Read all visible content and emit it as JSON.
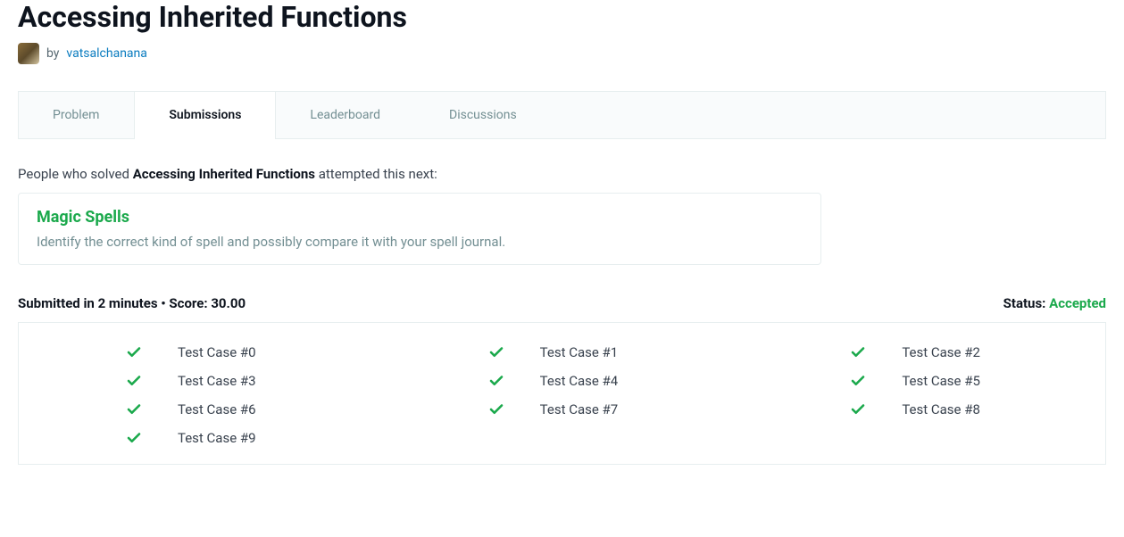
{
  "title": "Accessing Inherited Functions",
  "byline": {
    "prefix": "by ",
    "author": "vatsalchanana"
  },
  "tabs": [
    {
      "label": "Problem",
      "active": false
    },
    {
      "label": "Submissions",
      "active": true
    },
    {
      "label": "Leaderboard",
      "active": false
    },
    {
      "label": "Discussions",
      "active": false
    }
  ],
  "nextPrompt": {
    "prefix": "People who solved ",
    "strong": "Accessing Inherited Functions",
    "suffix": " attempted this next:"
  },
  "nextCard": {
    "title": "Magic Spells",
    "desc": "Identify the correct kind of spell and possibly compare it with your spell journal."
  },
  "result": {
    "left": "Submitted in 2 minutes • Score: 30.00",
    "statusLabel": "Status: ",
    "statusValue": "Accepted"
  },
  "testcases": [
    {
      "label": "Test Case #0"
    },
    {
      "label": "Test Case #1"
    },
    {
      "label": "Test Case #2"
    },
    {
      "label": "Test Case #3"
    },
    {
      "label": "Test Case #4"
    },
    {
      "label": "Test Case #5"
    },
    {
      "label": "Test Case #6"
    },
    {
      "label": "Test Case #7"
    },
    {
      "label": "Test Case #8"
    },
    {
      "label": "Test Case #9"
    }
  ]
}
